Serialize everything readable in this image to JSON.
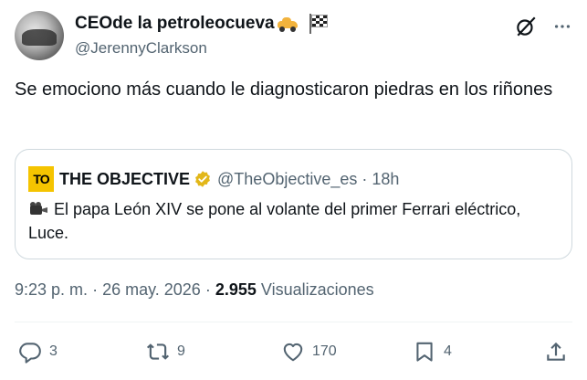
{
  "author": {
    "display_name": "CEOde la petroleocueva",
    "username": "@JerennyClarkson",
    "emojis": [
      "car-emoji",
      "checkered-flag-emoji"
    ]
  },
  "tweet": {
    "text": "Se emociono más cuando le diagnosticaron piedras en los riñones"
  },
  "quote": {
    "logo_text": "TO",
    "name": "THE OBJECTIVE",
    "handle": "@TheObjective_es",
    "separator": "·",
    "time": "18h",
    "text": "El papa León XIV se pone al volante del primer Ferrari eléctrico, Luce."
  },
  "meta": {
    "time": "9:23 p. m.",
    "sep1": "·",
    "date": "26 may. 2026",
    "sep2": "·",
    "views_count": "2.955",
    "views_label": "Visualizaciones"
  },
  "actions": {
    "replies": "3",
    "reposts": "9",
    "likes": "170",
    "bookmarks": "4"
  },
  "colors": {
    "text": "#0f1419",
    "secondary": "#536471",
    "border": "#cfd9de",
    "verified_gold": "#e2b719",
    "logo_yellow": "#f5c400"
  }
}
